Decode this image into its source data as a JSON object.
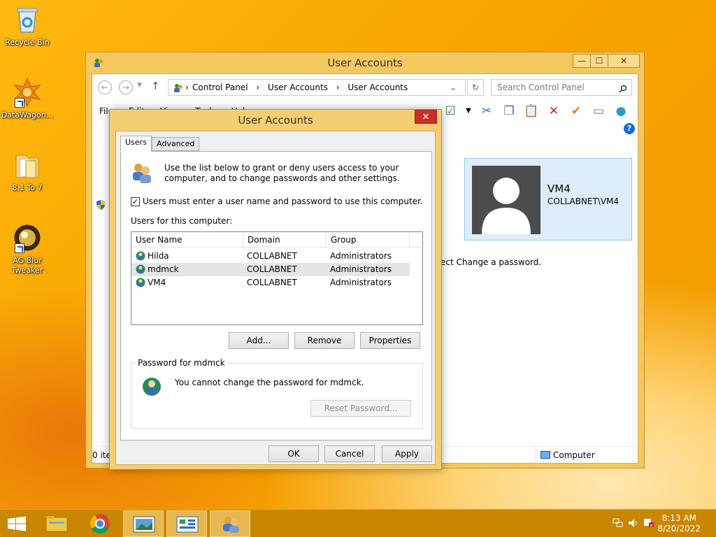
{
  "desktop": {
    "icons": [
      {
        "label": "Recycle Bin"
      },
      {
        "label": "DataWagon..."
      },
      {
        "label": "8.1 To 7"
      },
      {
        "label": "AG Blur Tweaker"
      }
    ]
  },
  "explorer": {
    "title": "User Accounts",
    "window_buttons": {
      "minimize": "—",
      "maximize": "☐",
      "close": "✕"
    },
    "breadcrumb": [
      "Control Panel",
      "User Accounts",
      "User Accounts"
    ],
    "search_placeholder": "Search Control Panel",
    "menu": "File Edit View Tools Help",
    "user_card": {
      "name": "VM4",
      "domain": "COLLABNET\\VM4"
    },
    "background_text": "ect Change a password.",
    "status_left": "0 ite",
    "status_right": "Computer"
  },
  "dialog": {
    "title": "User Accounts",
    "close": "✕",
    "tabs": [
      "Users",
      "Advanced"
    ],
    "intro": "Use the list below to grant or deny users access to your computer, and to change passwords and other settings.",
    "checkbox": {
      "label": "Users must enter a user name and password to use this computer.",
      "checked": true,
      "mark": "✓"
    },
    "users_label": "Users for this computer:",
    "columns": [
      "User Name",
      "Domain",
      "Group"
    ],
    "rows": [
      {
        "name": "Hilda",
        "domain": "COLLABNET",
        "group": "Administrators"
      },
      {
        "name": "mdmck",
        "domain": "COLLABNET",
        "group": "Administrators"
      },
      {
        "name": "VM4",
        "domain": "COLLABNET",
        "group": "Administrators"
      }
    ],
    "buttons": {
      "add": "Add...",
      "remove": "Remove",
      "properties": "Properties"
    },
    "password_group": {
      "label": "Password for mdmck",
      "text": "You cannot change the password for mdmck.",
      "reset": "Reset Password..."
    },
    "footer": {
      "ok": "OK",
      "cancel": "Cancel",
      "apply": "Apply"
    }
  },
  "taskbar": {
    "time": "8:13 AM",
    "date": "8/20/2022"
  },
  "colors": {
    "accent": "#f5a800",
    "selection": "#e5e5e5",
    "close_red": "#c7302a"
  }
}
